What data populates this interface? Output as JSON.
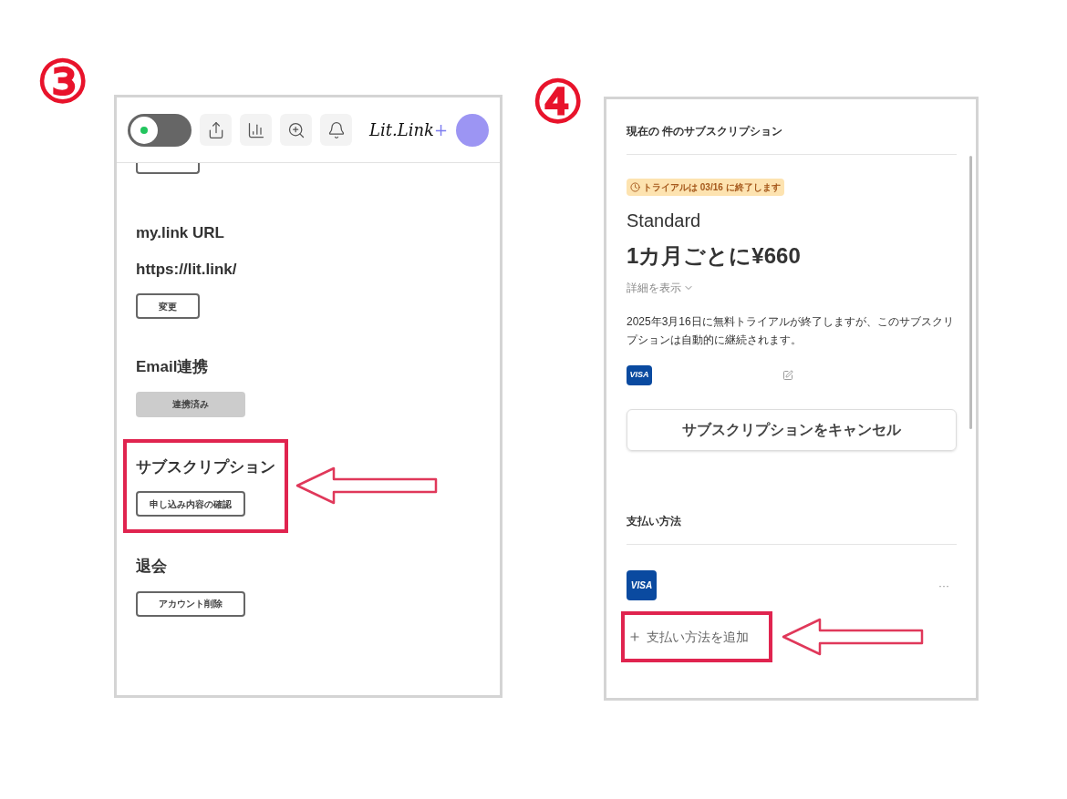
{
  "steps": [
    {
      "number": "③"
    },
    {
      "number": "④"
    }
  ],
  "profile_screen": {
    "toggle": {
      "on": true
    },
    "logo": "Lit.Link",
    "logo_plus": "+",
    "sections": [
      {
        "title": "my.link URL",
        "value": "https://lit.link/",
        "button": "変更",
        "kind": "outline",
        "highlighted": false
      },
      {
        "title": "Email連携",
        "button": "連携済み",
        "kind": "filled",
        "highlighted": false
      },
      {
        "title": "サブスクリプション",
        "button": "申し込み内容の確認",
        "kind": "outline",
        "highlighted": true
      },
      {
        "title": "退会",
        "button": "アカウント削除",
        "kind": "outline",
        "highlighted": false
      }
    ]
  },
  "subscription_screen": {
    "heading": "現在の 件のサブスクリプション",
    "trial_badge": "トライアルは 03/16 に終了します",
    "plan": "Standard",
    "price": "1カ月ごとに¥660",
    "details_link": "詳細を表示",
    "notice": "2025年3月16日に無料トライアルが終了しますが、このサブスクリプションは自動的に継続されます。",
    "card_brand_small": "VISA",
    "cancel_button": "サブスクリプションをキャンセル",
    "payment_heading": "支払い方法",
    "card_brand": "VISA",
    "more": "···",
    "add_payment": "支払い方法を追加",
    "add_payment_highlighted": true
  }
}
